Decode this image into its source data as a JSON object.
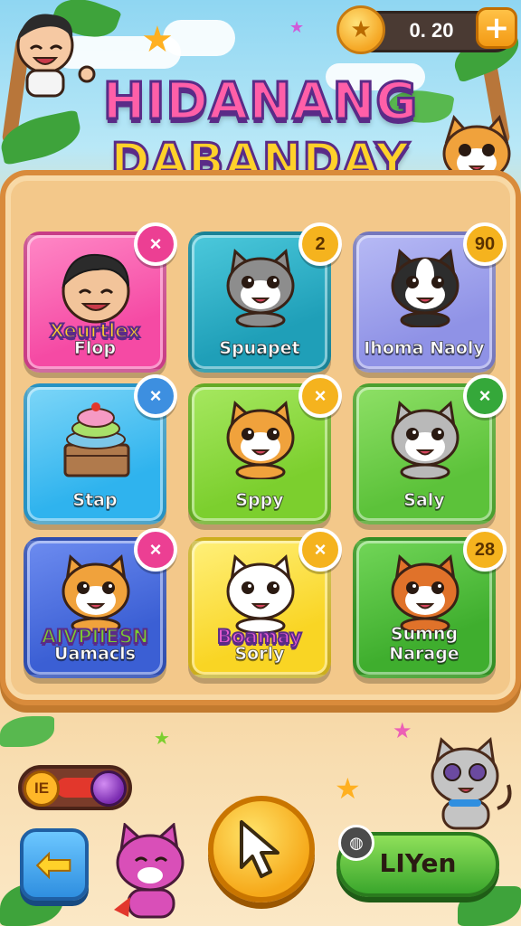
{
  "title": {
    "line1": "HIDANANG",
    "line2": "DABANDAY"
  },
  "currency": {
    "value": "0. 20",
    "plus_label": "+"
  },
  "cards": [
    {
      "id": "flop",
      "name": "Flop",
      "tag": "Xeurtlex",
      "badge": "×",
      "badge_color": "#ec3f93",
      "bg": "#f54aa4",
      "bg2": "#ff88c6",
      "animal": "boy",
      "fur": "#f2c49a"
    },
    {
      "id": "spuapet",
      "name": "Spuapet",
      "badge": "2",
      "badge_color": "#f5b31e",
      "bg": "#1f9fb8",
      "bg2": "#4cc9dc",
      "animal": "cat",
      "fur": "#8d8d8d"
    },
    {
      "id": "ihoma",
      "name": "Ihoma Naoly",
      "badge": "90",
      "badge_color": "#f5b31e",
      "bg": "#8f92e6",
      "bg2": "#b7baf5",
      "animal": "dog",
      "fur": "#2d2d2d"
    },
    {
      "id": "stap",
      "name": "Stap",
      "badge": "×",
      "badge_color": "#3d8fe0",
      "bg": "#2fb3ee",
      "bg2": "#7dd6f8",
      "animal": "cake",
      "fur": "#b07a4c"
    },
    {
      "id": "sppy",
      "name": "Sppy",
      "badge": "×",
      "badge_color": "#f5b31e",
      "bg": "#7ccf2e",
      "bg2": "#a6e860",
      "animal": "cat",
      "fur": "#f0a23c"
    },
    {
      "id": "saly",
      "name": "Saly",
      "badge": "×",
      "badge_color": "#35a83a",
      "bg": "#5cc23a",
      "bg2": "#8ee066",
      "animal": "cat",
      "fur": "#b9b9b9"
    },
    {
      "id": "uamacls",
      "name": "Uamacls",
      "tag": "AIVPIIESN",
      "badge": "×",
      "badge_color": "#ec3f93",
      "bg": "#3b5fd4",
      "bg2": "#6d8cf0",
      "animal": "cat",
      "fur": "#f0a23c"
    },
    {
      "id": "sorly",
      "name": "Sorly",
      "tag": "Boamay",
      "badge": "×",
      "badge_color": "#f5b31e",
      "bg": "#f9d524",
      "bg2": "#fff07a",
      "animal": "cat",
      "fur": "#ffffff"
    },
    {
      "id": "sumng",
      "name": "Sumng Narage",
      "badge": "28",
      "badge_color": "#f5b31e",
      "bg": "#3fae2e",
      "bg2": "#72d658",
      "animal": "cat",
      "fur": "#e0722a"
    }
  ],
  "controls": {
    "toggle_label": "IE",
    "back_icon": "left-arrow-icon",
    "cursor_icon": "pointer-cursor-icon",
    "go_label": "LIYen"
  },
  "colors": {
    "accent": "#5a2b87",
    "coin": "#f5a623"
  }
}
